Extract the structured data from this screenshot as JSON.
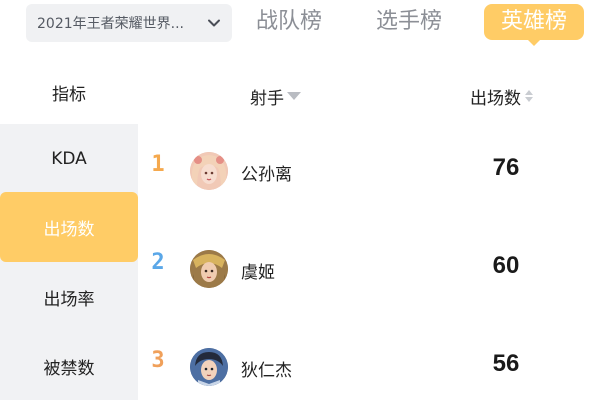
{
  "header": {
    "season_select": "2021年王者荣耀世界...",
    "tabs": [
      {
        "label": "战队榜",
        "active": false
      },
      {
        "label": "选手榜",
        "active": false
      },
      {
        "label": "英雄榜",
        "active": true
      }
    ],
    "accent_color": "#ffcc66"
  },
  "table_header": {
    "metric_column": "指标",
    "role_filter": "射手",
    "sort_column": "出场数"
  },
  "sidebar": {
    "items": [
      {
        "label": "KDA",
        "active": false
      },
      {
        "label": "出场数",
        "active": true
      },
      {
        "label": "出场率",
        "active": false
      },
      {
        "label": "被禁数",
        "active": false
      }
    ]
  },
  "rankings": [
    {
      "rank": "1",
      "rank_color": "#f5a94e",
      "hero": "公孙离",
      "value": "76",
      "avatar_icon": "hero-portrait-icon"
    },
    {
      "rank": "2",
      "rank_color": "#5aa7e8",
      "hero": "虞姬",
      "value": "60",
      "avatar_icon": "hero-portrait-icon"
    },
    {
      "rank": "3",
      "rank_color": "#f0a05a",
      "hero": "狄仁杰",
      "value": "56",
      "avatar_icon": "hero-portrait-icon"
    }
  ]
}
